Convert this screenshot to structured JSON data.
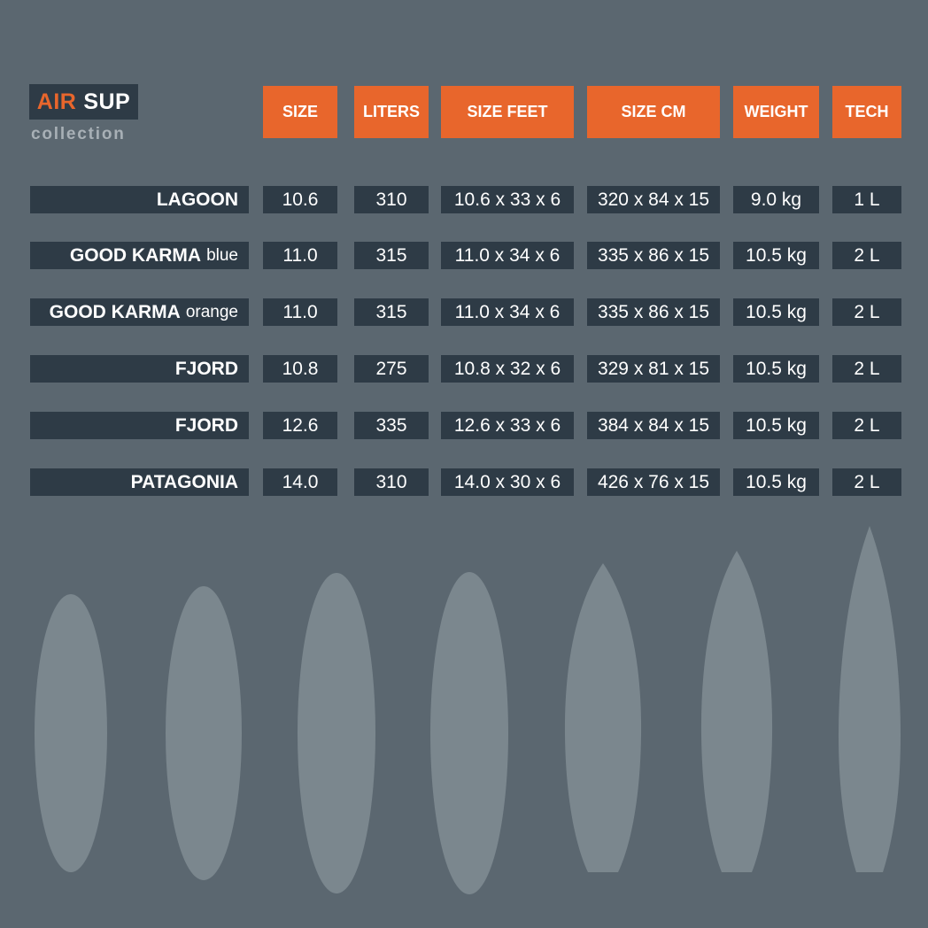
{
  "logo": {
    "word1": "AIR",
    "word2": "SUP",
    "subtitle": "collection"
  },
  "colors": {
    "background": "#5b6770",
    "accent": "#e8662c",
    "row": "#2e3b46",
    "board": "#7b878e",
    "subtitle": "#a8b0b6"
  },
  "headers": [
    "SIZE",
    "LITERS",
    "SIZE FEET",
    "SIZE CM",
    "WEIGHT",
    "TECH"
  ],
  "rows": [
    {
      "name": "LAGOON",
      "variant": "",
      "cells": [
        "10.6",
        "310",
        "10.6 x 33 x 6",
        "320 x 84 x 15",
        "9.0 kg",
        "1 L"
      ]
    },
    {
      "name": "GOOD KARMA",
      "variant": "blue",
      "cells": [
        "11.0",
        "315",
        "11.0 x 34 x 6",
        "335 x 86 x 15",
        "10.5 kg",
        "2 L"
      ]
    },
    {
      "name": "GOOD KARMA",
      "variant": "orange",
      "cells": [
        "11.0",
        "315",
        "11.0 x 34 x 6",
        "335 x 86 x 15",
        "10.5 kg",
        "2 L"
      ]
    },
    {
      "name": "FJORD",
      "variant": "",
      "cells": [
        "10.8",
        "275",
        "10.8 x 32 x 6",
        "329 x 81 x 15",
        "10.5 kg",
        "2 L"
      ]
    },
    {
      "name": "FJORD",
      "variant": "",
      "cells": [
        "12.6",
        "335",
        "12.6 x 33 x 6",
        "384 x 84 x 15",
        "10.5 kg",
        "2 L"
      ]
    },
    {
      "name": "PATAGONIA",
      "variant": "",
      "cells": [
        "14.0",
        "310",
        "14.0 x 30 x 6",
        "426 x 76 x 15",
        "10.5 kg",
        "2 L"
      ]
    }
  ]
}
